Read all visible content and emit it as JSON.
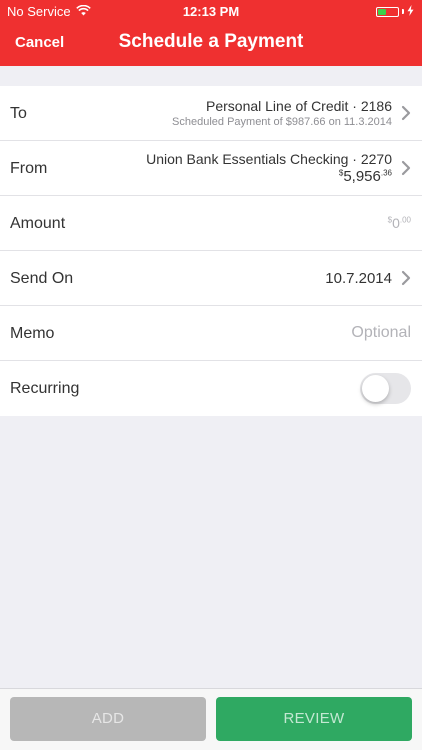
{
  "status_bar": {
    "carrier": "No Service",
    "time": "12:13 PM",
    "wifi_icon": "wifi-icon",
    "battery_icon": "battery-icon",
    "charging_icon": "charging-bolt-icon",
    "battery_color": "#3ad24a"
  },
  "nav": {
    "cancel_label": "Cancel",
    "title": "Schedule a Payment",
    "bar_color": "#ef3030"
  },
  "form": {
    "to": {
      "label": "To",
      "account": "Personal Line of Credit · 2186",
      "scheduled": "Scheduled Payment of $987.66 on 11.3.2014"
    },
    "from": {
      "label": "From",
      "account": "Union Bank Essentials Checking · 2270",
      "balance_symbol": "$",
      "balance_dollars": "5,956",
      "balance_cents": ".36"
    },
    "amount": {
      "label": "Amount",
      "symbol": "$",
      "dollars": "0",
      "cents": ".00"
    },
    "send_on": {
      "label": "Send On",
      "value": "10.7.2014"
    },
    "memo": {
      "label": "Memo",
      "placeholder": "Optional",
      "value": ""
    },
    "recurring": {
      "label": "Recurring",
      "on": false
    }
  },
  "footer": {
    "add_label": "ADD",
    "review_label": "REVIEW",
    "review_color": "#2fa962"
  }
}
